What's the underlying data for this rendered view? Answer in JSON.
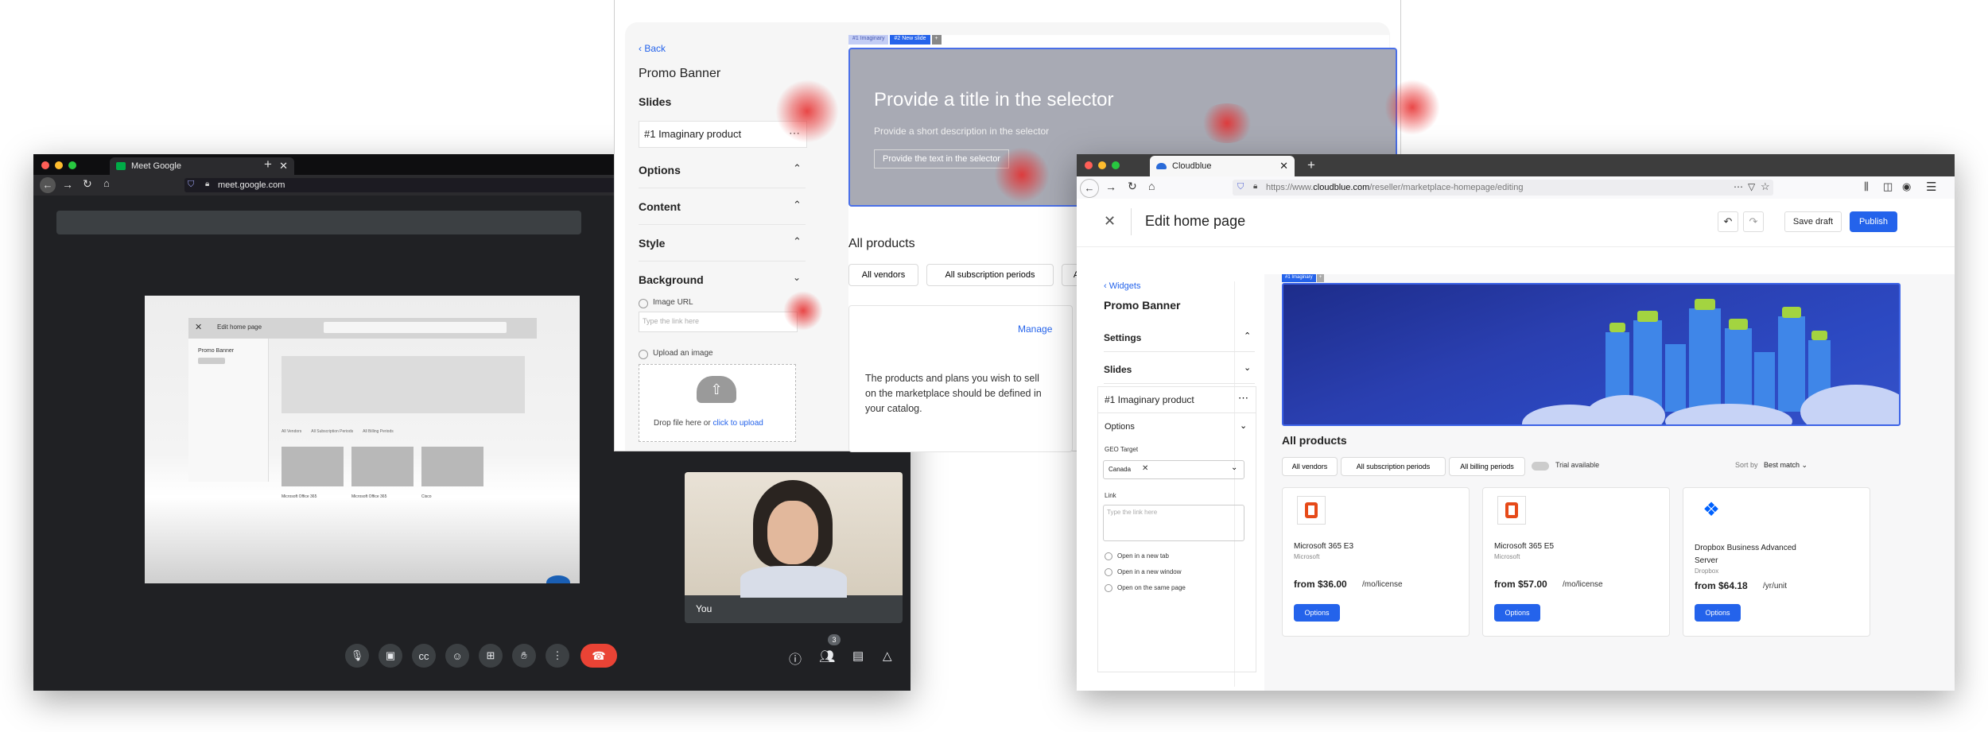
{
  "meet": {
    "tab_title": "Meet Google",
    "url": "meet.google.com",
    "shared": {
      "title": "Edit home page",
      "sidebar_title": "Promo Banner",
      "filters": [
        "All Vendors",
        "All Subscription Periods",
        "All Billing Periods"
      ],
      "cards": [
        "Microsoft Office 365",
        "Microsoft Office 365",
        "Cisco"
      ]
    },
    "self_label": "You",
    "participants_count": "3"
  },
  "editor": {
    "back_label": "Back",
    "title": "Promo Banner",
    "slides_label": "Slides",
    "slide_item": "#1  Imaginary product",
    "sections": [
      "Options",
      "Content",
      "Style",
      "Background"
    ],
    "image_url_label": "Image URL",
    "image_url_placeholder": "Type the link here",
    "upload_label": "Upload an image",
    "drop_text": "Drop file here or",
    "drop_link": "click to upload",
    "slide_tabs": [
      "#1 Imaginary",
      "#2 New slide",
      "+"
    ],
    "banner_title": "Provide a title in the selector",
    "banner_desc": "Provide a short description in the selector",
    "banner_button": "Provide the text in the selector",
    "all_products": "All products",
    "filters": [
      "All vendors",
      "All subscription periods",
      "All"
    ],
    "manage": "Manage",
    "empty_text": "The products and plans you wish to sell on the marketplace should be defined in your catalog."
  },
  "cloudblue": {
    "tab_title": "Cloudblue",
    "url_prefix": "https://www.",
    "url_domain": "cloudblue.com",
    "url_path": "/reseller/marketplace-homepage/editing",
    "page_title": "Edit home page",
    "save_draft": "Save draft",
    "publish": "Publish",
    "widgets_back": "Widgets",
    "widget_title": "Promo Banner",
    "settings_label": "Settings",
    "slides_label": "Slides",
    "slide_item": "#1  Imaginary product",
    "options_label": "Options",
    "geo_label": "GEO Target",
    "geo_value": "Canada",
    "link_label": "Link",
    "link_placeholder": "Type the link here",
    "open_options": [
      "Open in a new tab",
      "Open in a new window",
      "Open on the same page"
    ],
    "slide_tabs": [
      "#1 Imaginary",
      "+"
    ],
    "all_products": "All products",
    "filters": [
      "All vendors",
      "All subscription periods",
      "All billing periods"
    ],
    "trial_label": "Trial available",
    "sort_label": "Sort by",
    "sort_value": "Best match",
    "products": [
      {
        "name": "Microsoft 365 E3",
        "vendor": "Microsoft",
        "price": "from $36.00",
        "unit": "/mo/license",
        "button": "Options",
        "logo": "office-logo"
      },
      {
        "name": "Microsoft 365 E5",
        "vendor": "Microsoft",
        "price": "from $57.00",
        "unit": "/mo/license",
        "button": "Options",
        "logo": "office-logo"
      },
      {
        "name": "Dropbox Business Advanced Server",
        "vendor": "Dropbox",
        "price": "from $64.18",
        "unit": "/yr/unit",
        "button": "Options",
        "logo": "dropbox-logo"
      }
    ]
  }
}
